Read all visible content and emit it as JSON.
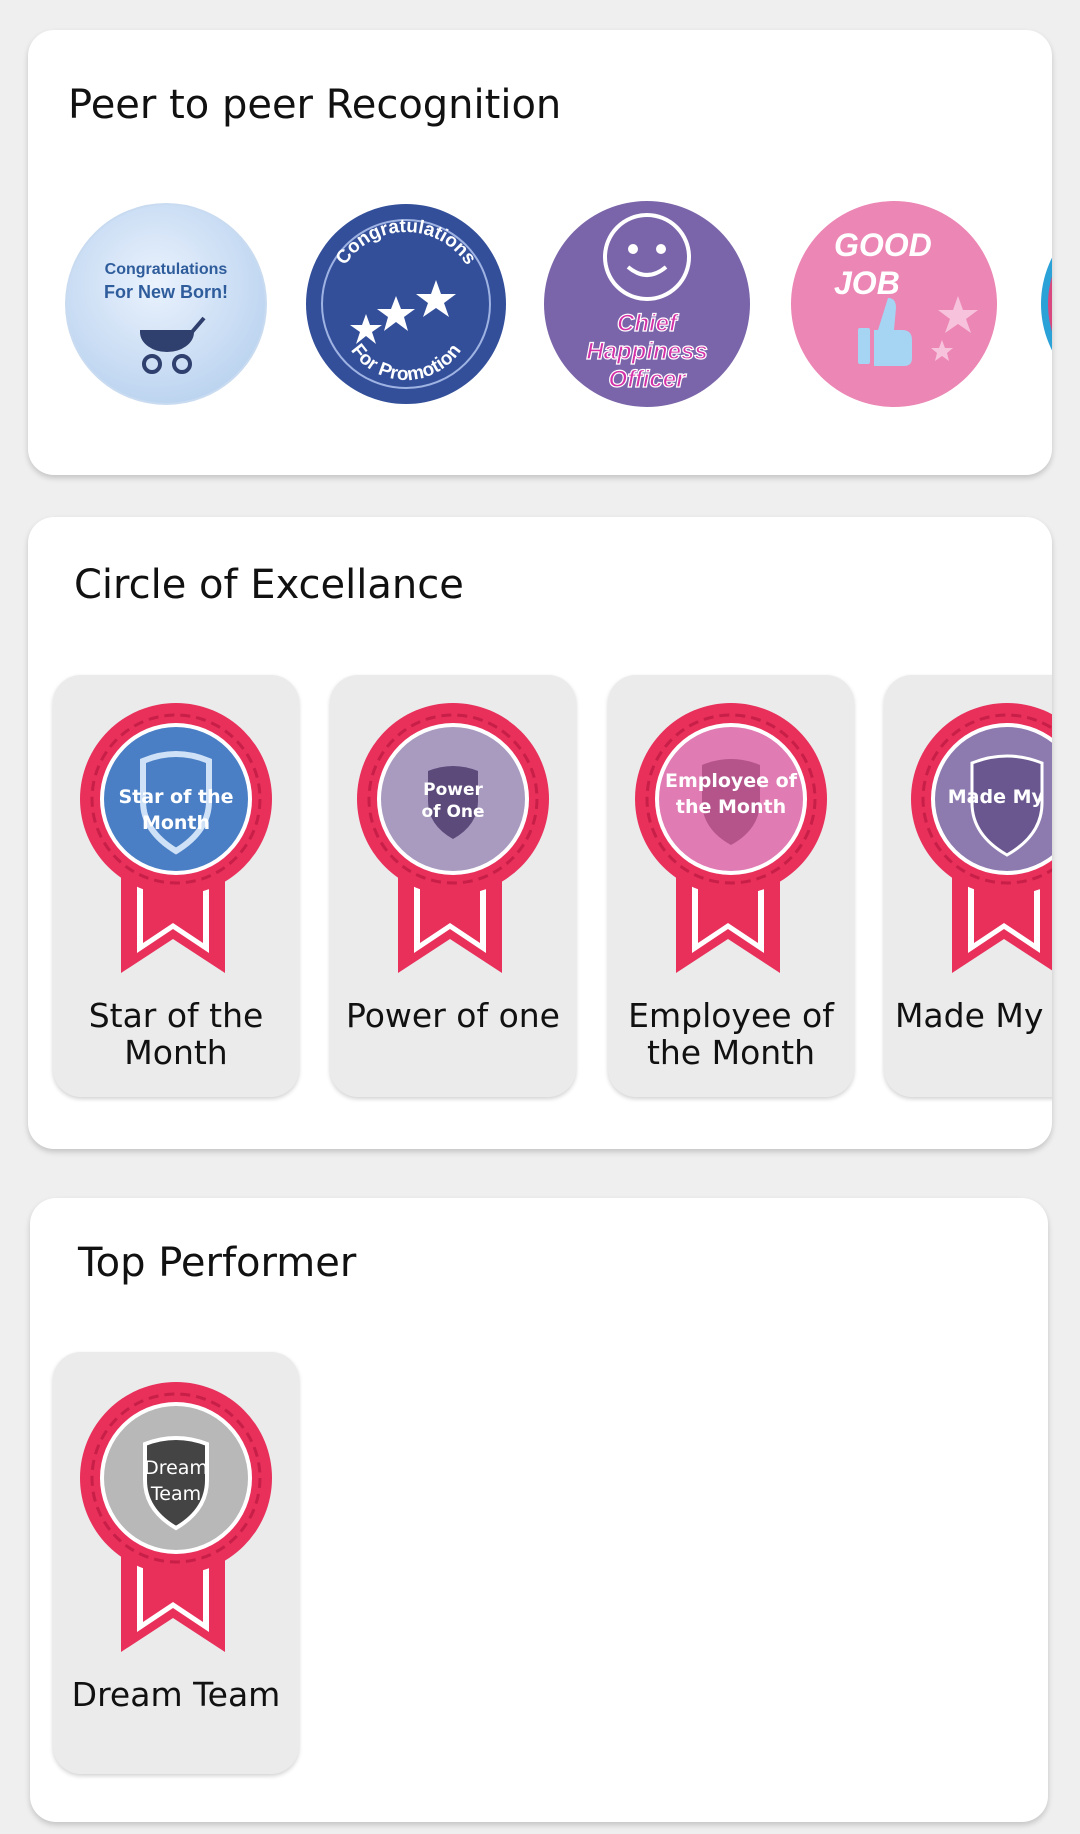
{
  "sections": {
    "peer": {
      "title": "Peer to peer Recognition",
      "badges": [
        {
          "name": "congrats-new-born",
          "line1": "Congratulations",
          "line2": "For New Born!"
        },
        {
          "name": "congrats-promotion",
          "arc_top": "Congratulations",
          "arc_bottom": "For Promotion"
        },
        {
          "name": "chief-happiness-officer",
          "line1": "Chief",
          "line2": "Happiness",
          "line3": "Officer"
        },
        {
          "name": "good-job",
          "line1": "GOOD",
          "line2": "JOB"
        }
      ]
    },
    "excellence": {
      "title": "Circle of Excellance",
      "awards": [
        {
          "label": "Star of the Month",
          "badge_text1": "Star of the",
          "badge_text2": "Month",
          "color": "#4a7fc6"
        },
        {
          "label": "Power of one",
          "badge_text1": "Power",
          "badge_text2": "of One",
          "color": "#a99bc0"
        },
        {
          "label": "Employee of the Month",
          "badge_text1": "Employee of",
          "badge_text2": "the Month",
          "color": "#e07bb3"
        },
        {
          "label": "Made My Day",
          "badge_text1": "Made My D",
          "badge_text2": "",
          "color": "#8d7bb0"
        }
      ]
    },
    "top": {
      "title": "Top Performer",
      "awards": [
        {
          "label": "Dream Team",
          "badge_text1": "Dream",
          "badge_text2": "Team",
          "color": "#b8b8b8"
        }
      ]
    }
  },
  "colors": {
    "ribbon": "#e8305b",
    "card": "#ffffff",
    "background": "#efefef",
    "tile": "#ebebeb"
  }
}
